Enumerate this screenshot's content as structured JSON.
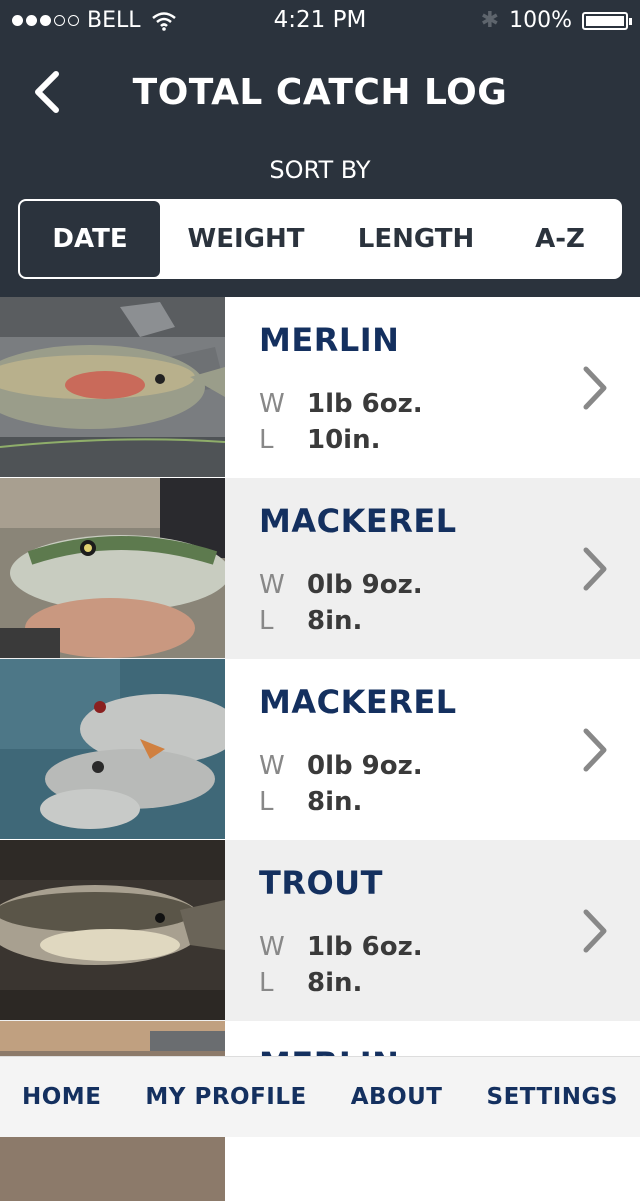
{
  "status": {
    "carrier": "BELL",
    "time": "4:21 PM",
    "battery": "100%"
  },
  "header": {
    "title": "TOTAL CATCH LOG",
    "sort_label": "SORT BY"
  },
  "sort": {
    "options": [
      "DATE",
      "WEIGHT",
      "LENGTH",
      "A-Z"
    ],
    "selected": "DATE"
  },
  "catches": [
    {
      "name": "MERLIN",
      "weight_label": "W",
      "weight": "1lb 6oz.",
      "length_label": "L",
      "length": "10in."
    },
    {
      "name": "MACKEREL",
      "weight_label": "W",
      "weight": "0lb 9oz.",
      "length_label": "L",
      "length": "8in."
    },
    {
      "name": "MACKEREL",
      "weight_label": "W",
      "weight": "0lb 9oz.",
      "length_label": "L",
      "length": "8in."
    },
    {
      "name": "TROUT",
      "weight_label": "W",
      "weight": "1lb 6oz.",
      "length_label": "L",
      "length": "8in."
    },
    {
      "name": "MERLIN"
    }
  ],
  "tabs": [
    "HOME",
    "MY PROFILE",
    "ABOUT",
    "SETTINGS"
  ],
  "colors": {
    "header_bg": "#2b333d",
    "accent": "#14305f",
    "alt_row": "#efefef"
  }
}
